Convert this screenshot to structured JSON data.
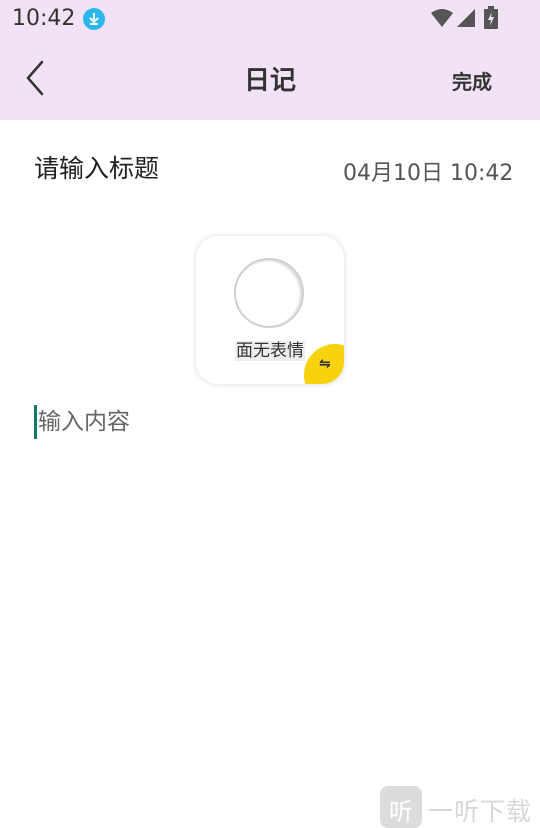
{
  "status_bar": {
    "time": "10:42",
    "icons": [
      "download-indicator-icon",
      "wifi-icon",
      "signal-icon",
      "battery-charging-icon"
    ]
  },
  "header": {
    "title": "日记",
    "back_icon": "chevron-left-icon",
    "done_label": "完成",
    "background": "#f1e3f5"
  },
  "entry": {
    "title_placeholder": "请输入标题",
    "datetime": "04月10日 10:42",
    "content_placeholder": "输入内容"
  },
  "mood": {
    "label": "面无表情",
    "swap_icon": "swap-icon",
    "badge_color": "#f8d20c"
  },
  "watermark": {
    "logo_char": "听",
    "text": "一听下载"
  }
}
